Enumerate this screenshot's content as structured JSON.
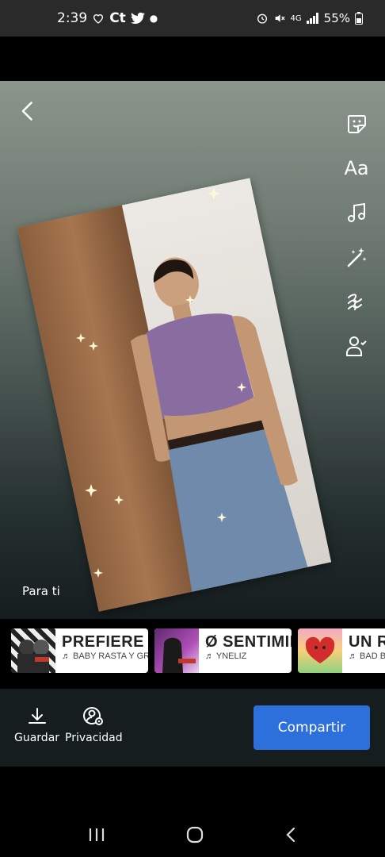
{
  "status_bar": {
    "time": "2:39",
    "left_icons": [
      "heart-icon",
      "ct-icon",
      "twitter-icon",
      "dot-icon"
    ],
    "network": "4G",
    "battery": "55%"
  },
  "editor": {
    "caption": "Para ti",
    "tools": [
      "sticker-icon",
      "Aa",
      "music-note-icon",
      "magic-wand-icon",
      "filter-icon",
      "tag-person-icon"
    ]
  },
  "music": [
    {
      "title": "PREFIERE ES",
      "artist": "♬ BABY RASTA Y GRINGO"
    },
    {
      "title": "Ø SENTIMIEN",
      "artist": "♬ YNELIZ"
    },
    {
      "title": "UN RA",
      "artist": "♬ BAD BUN"
    }
  ],
  "actions": {
    "save_label": "Guardar",
    "privacy_label": "Privacidad",
    "share_label": "Compartir"
  },
  "colors": {
    "accent": "#2d6fdb"
  }
}
